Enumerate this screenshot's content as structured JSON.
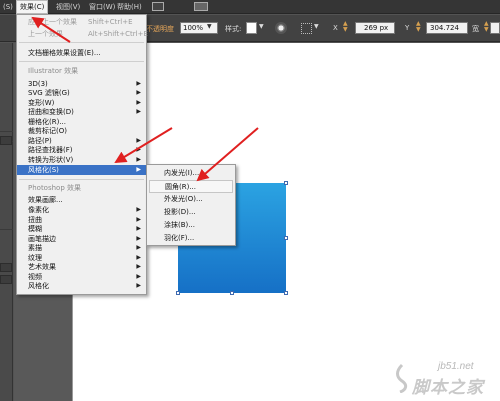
{
  "menubar": {
    "partial_item": "(S)",
    "effect_label": "效果(C)",
    "view_label": "视图(V)",
    "window_label": "窗口(W)",
    "help_label": "帮助(H)"
  },
  "control_bar": {
    "opacity_label": "不透明度",
    "opacity_value": "100%",
    "style_label": "样式",
    "style_suffix": ":",
    "x_label": "X",
    "x_value": "269 px",
    "y_label": "Y",
    "y_value": "304.724",
    "w_label": "宽"
  },
  "effect_menu": {
    "apply_last": "应用上一个效果",
    "apply_last_shortcut": "Shift+Ctrl+E",
    "last_effect": "上一个效果",
    "last_effect_shortcut": "Alt+Shift+Ctrl+E",
    "raster_settings": "文档栅格效果设置(E)...",
    "illustrator_section": "Illustrator 效果",
    "illustrator_items": [
      "3D(3)",
      "SVG 滤镜(G)",
      "变形(W)",
      "扭曲和变换(D)",
      "栅格化(R)...",
      "裁剪标记(O)",
      "路径(P)",
      "路径查找器(F)",
      "转换为形状(V)",
      "风格化(S)"
    ],
    "photoshop_section": "Photoshop 效果",
    "photoshop_items": [
      "效果画廊...",
      "像素化",
      "扭曲",
      "模糊",
      "画笔描边",
      "素描",
      "纹理",
      "艺术效果",
      "视频",
      "风格化"
    ]
  },
  "stylize_submenu": {
    "items": [
      "内发光(I)...",
      "圆角(R)...",
      "外发光(O)...",
      "投影(D)...",
      "涂抹(B)...",
      "羽化(F)..."
    ]
  },
  "colors": {
    "highlight": "#3a72c6",
    "arrow": "#e02020",
    "shape_top": "#2ba3e2",
    "shape_bottom": "#1670c6"
  },
  "watermark": {
    "site": "jb51.net",
    "brand": "脚本之家"
  }
}
